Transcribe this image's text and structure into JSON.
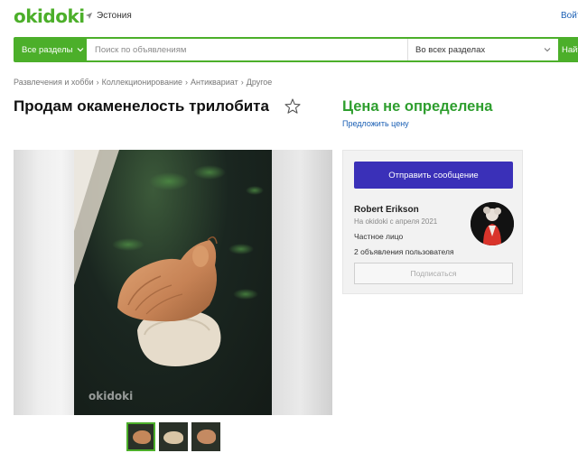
{
  "header": {
    "logo": "okidoki",
    "location": "Эстония",
    "login_label": "Войти"
  },
  "search": {
    "all_sections_label": "Все разделы",
    "placeholder": "Поиск по объявлениям",
    "scope_label": "Во всех разделах",
    "find_label": "Найти"
  },
  "breadcrumb": [
    "Развлечения и хобби",
    "Коллекционирование",
    "Антиквариат",
    "Другое"
  ],
  "listing": {
    "title": "Продам окаменелость трилобита",
    "price": "Цена не определена",
    "offer_price_label": "Предложить цену",
    "watermark": "okidoki",
    "thumbnail_count": 3
  },
  "seller": {
    "send_message_label": "Отправить сообщение",
    "name": "Robert Erikson",
    "since": "На okidoki с апреля 2021",
    "type": "Частное лицо",
    "listings": "2 объявления пользователя",
    "subscribe_label": "Подписаться"
  },
  "colors": {
    "brand_green": "#4caf2a",
    "price_green": "#2e9e2e",
    "button_blue": "#3a30b8",
    "link_blue": "#1a5fb4"
  }
}
